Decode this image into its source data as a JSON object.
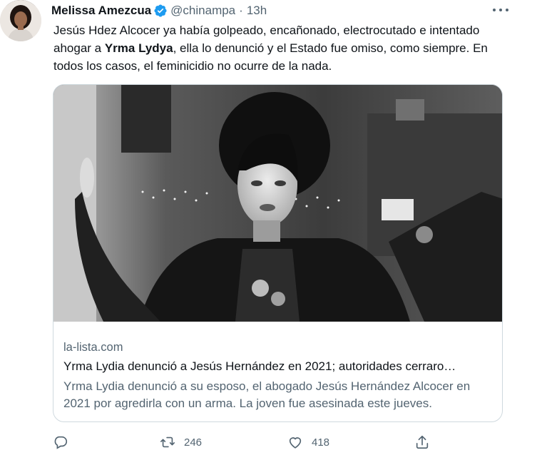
{
  "tweet": {
    "display_name": "Melissa Amezcua",
    "handle": "@chinampa",
    "separator": "·",
    "time": "13h",
    "text_part1": "Jesús Hdez Alcocer ya había golpeado, encañonado, electrocutado e intentado ahogar a ",
    "text_bold": "Yrma Lydya",
    "text_part2": ", ella lo denunció y el Estado fue omiso, como siempre. En todos los casos, el feminicidio no ocurre de la nada."
  },
  "card": {
    "domain": "la-lista.com",
    "title": "Yrma Lydia denunció a Jesús Hernández en 2021; autoridades cerraro…",
    "description": "Yrma Lydia denunció a su esposo, el abogado Jesús Hernández Alcocer en 2021 por agredirla con un arma. La joven fue asesinada este jueves."
  },
  "actions": {
    "retweets": "246",
    "likes": "418"
  },
  "colors": {
    "verified": "#1d9bf0",
    "secondary_text": "#536471",
    "primary_text": "#0f1419",
    "border": "#cfd9de"
  },
  "icons": [
    "verified-badge-icon",
    "more-icon",
    "reply-icon",
    "retweet-icon",
    "like-icon",
    "share-icon"
  ]
}
